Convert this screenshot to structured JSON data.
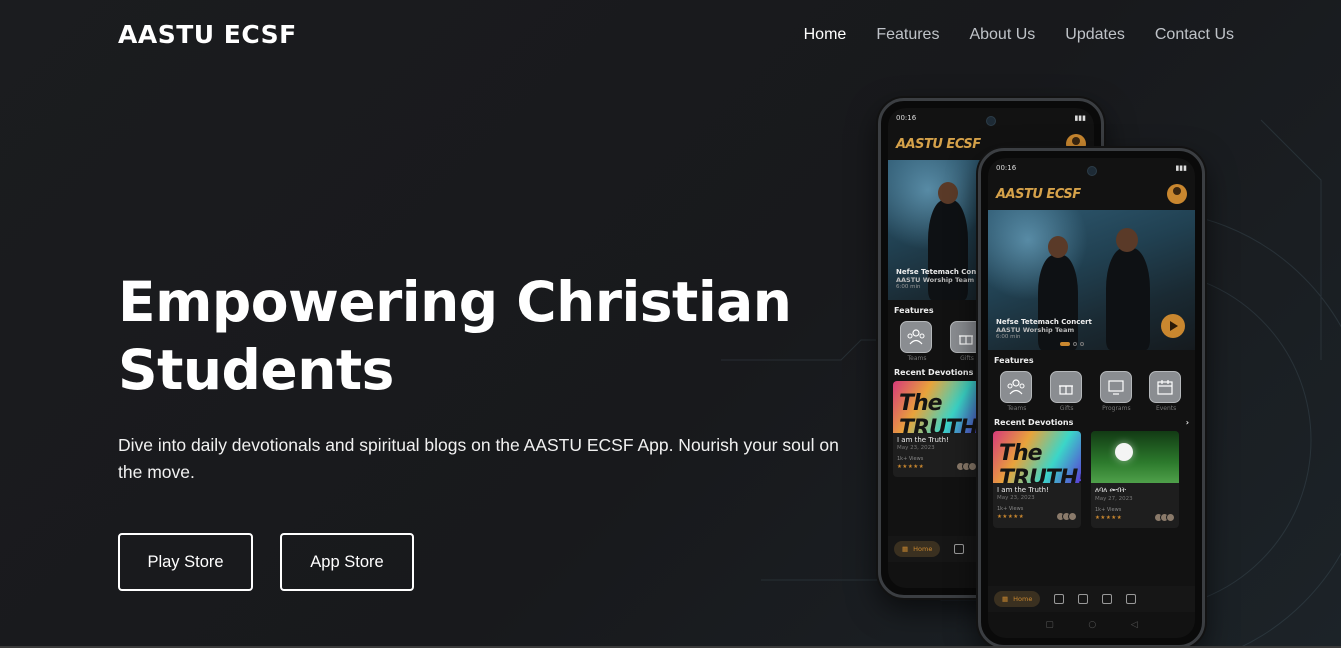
{
  "nav": {
    "brand": "AASTU ECSF",
    "links": [
      {
        "label": "Home",
        "active": true
      },
      {
        "label": "Features",
        "active": false
      },
      {
        "label": "About Us",
        "active": false
      },
      {
        "label": "Updates",
        "active": false
      },
      {
        "label": "Contact Us",
        "active": false
      }
    ]
  },
  "hero": {
    "title": "Empowering Christian Students",
    "description": "Dive into daily devotionals and spiritual blogs on the AASTU ECSF App. Nourish your soul on the move.",
    "play_store_label": "Play Store",
    "app_store_label": "App Store"
  },
  "phone": {
    "time": "00:16",
    "app_logo": "AASTU ECSF",
    "banner": {
      "title": "Nefse Tetemach Concert",
      "subtitle": "AASTU Worship Team",
      "duration": "6:00 min"
    },
    "features_label": "Features",
    "features": [
      "Teams",
      "Gifts",
      "Programs",
      "Events"
    ],
    "devotions_label": "Recent Devotions",
    "devotions": [
      {
        "title": "I am the Truth!",
        "date": "May 23, 2023",
        "views": "1k+ Views",
        "stars": "★★★★★",
        "image_text": "The TRUTH!"
      },
      {
        "title": "ለባለ መብት",
        "date": "May 27, 2023",
        "views": "1k+ Views",
        "stars": "★★★★★",
        "image_text": ""
      }
    ],
    "tab_home": "Home"
  },
  "colors": {
    "accent": "#c9872f",
    "background": "#1b1c1f",
    "text": "#ffffff"
  }
}
